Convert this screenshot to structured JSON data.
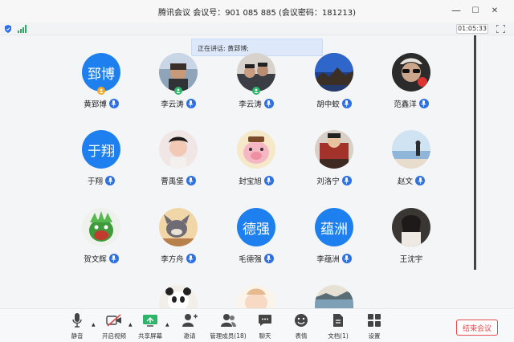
{
  "window": {
    "title": "腾讯会议  会议号：901 085 885  (会议密码：181213)",
    "minimize": "—",
    "maximize": "☐",
    "close": "✕"
  },
  "status": {
    "timer": "01:05:33"
  },
  "speaking_banner": "正在讲话: 黄郅博;",
  "participants": [
    {
      "name": "黄郅博",
      "avatar_text": "郅博",
      "mic": "active"
    },
    {
      "name": "李云涛",
      "avatar_text": "",
      "mic": "active"
    },
    {
      "name": "李云涛",
      "avatar_text": "",
      "mic": "normal"
    },
    {
      "name": "胡中蛟",
      "avatar_text": "",
      "mic": "normal"
    },
    {
      "name": "范鑫洋",
      "avatar_text": "",
      "mic": "normal"
    },
    {
      "name": "于翔",
      "avatar_text": "于翔",
      "mic": "normal"
    },
    {
      "name": "曹禹堡",
      "avatar_text": "",
      "mic": "normal"
    },
    {
      "name": "封宝旭",
      "avatar_text": "",
      "mic": "normal"
    },
    {
      "name": "刘洛宁",
      "avatar_text": "",
      "mic": "normal"
    },
    {
      "name": "赵文",
      "avatar_text": "",
      "mic": "normal"
    },
    {
      "name": "贺文辉",
      "avatar_text": "",
      "mic": "normal"
    },
    {
      "name": "李方舟",
      "avatar_text": "",
      "mic": "normal"
    },
    {
      "name": "毛德强",
      "avatar_text": "德强",
      "mic": "normal"
    },
    {
      "name": "李蕴洲",
      "avatar_text": "蕴洲",
      "mic": "normal"
    },
    {
      "name": "王沈宇",
      "avatar_text": "",
      "mic": "normal"
    }
  ],
  "toolbar": {
    "mute": "静音",
    "video": "开启视频",
    "share": "共享屏幕",
    "invite": "邀请",
    "members": "管理成员(18)",
    "chat": "聊天",
    "reaction": "表情",
    "docs": "文档(1)",
    "settings": "设置",
    "end": "结束会议"
  },
  "colors": {
    "accent": "#1e80ee",
    "mic_blue": "#2f6fe4",
    "host_badge": "#f5a623",
    "cohost_badge": "#2db56a",
    "end": "#e5484d"
  }
}
